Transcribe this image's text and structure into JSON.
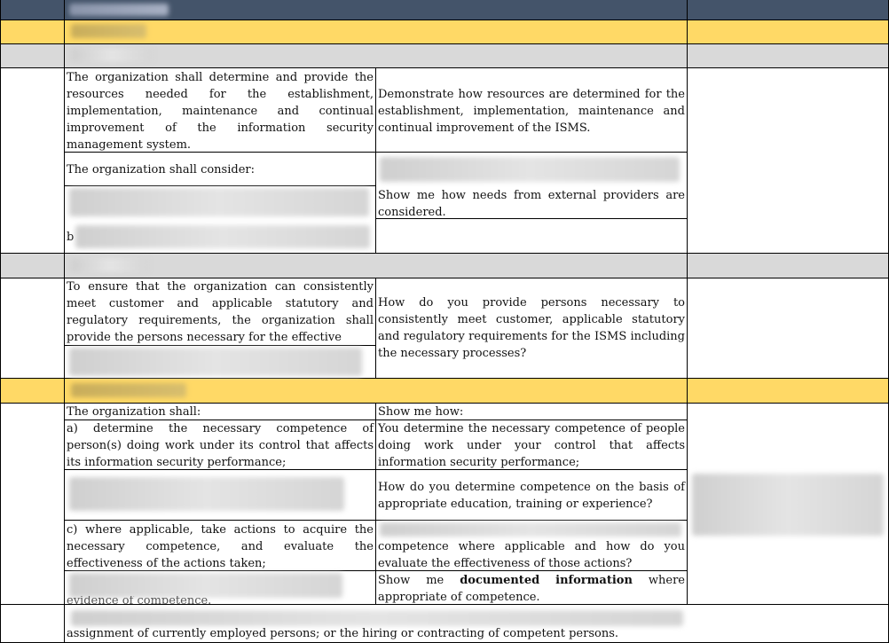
{
  "sections": {
    "resources": {
      "requirement": "The organization shall determine and provide the resources needed for the establishment, implementation, maintenance and continual improvement of the information security management system.",
      "question": "Demonstrate how resources are determined for the establishment, implementation, maintenance and continual improvement of the ISMS.",
      "consider_label": "The organization shall consider:",
      "external_question": "Show me how needs from external providers are considered.",
      "row_b_prefix": "b"
    },
    "people": {
      "requirement": "To ensure that the organization can consistently meet customer and applicable statutory and regulatory requirements, the organization shall provide the persons necessary for the effective",
      "question": "How do you provide persons necessary to consistently meet customer, applicable statutory and regulatory requirements for the ISMS including the necessary processes?"
    },
    "competence": {
      "intro_left": "The organization shall:",
      "intro_right": "Show me how:",
      "item_a": "a) determine the necessary competence of person(s) doing work under its control that affects its information security performance;",
      "item_a_question": "You determine the necessary competence of people doing work under your control that affects information security performance;",
      "item_b_question": "How do you determine competence on the basis of appropriate education, training or experience?",
      "item_c": "c) where applicable, take actions to acquire the necessary competence, and evaluate the effectiveness of the actions taken;",
      "item_c_question": "competence where applicable and how do you evaluate the effectiveness of those actions?",
      "item_d_show": "Show",
      "item_d_me": "me",
      "item_d_doc": "documented",
      "item_d_info": "information",
      "item_d_where": "where",
      "item_d_tail": "appropriate of competence.",
      "item_d_cut": "evidence of competence.",
      "note": "assignment of currently employed persons; or the hiring or contracting of competent persons."
    }
  },
  "colors": {
    "header": "#44546a",
    "highlight": "#ffd966",
    "gray": "#d9d9d9"
  }
}
